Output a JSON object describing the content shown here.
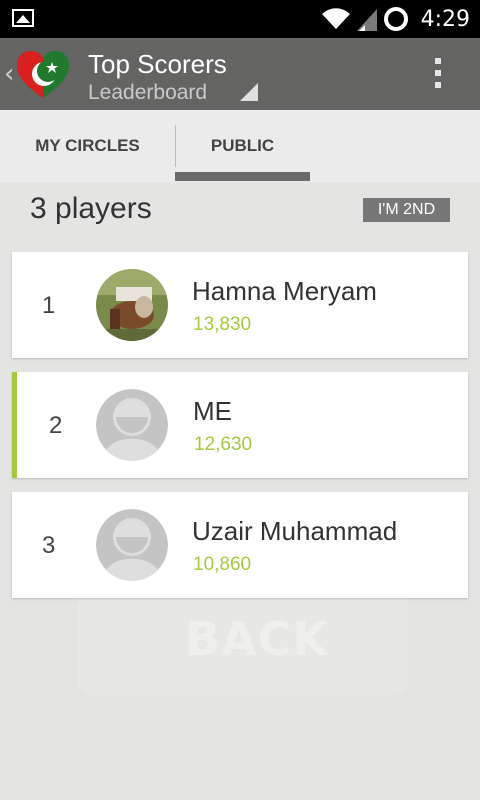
{
  "status_bar": {
    "time": "4:29",
    "icons": [
      "image-notification-icon",
      "wifi-icon",
      "signal-icon",
      "sync-icon"
    ]
  },
  "action_bar": {
    "title": "Top Scorers",
    "subtitle": "Leaderboard",
    "icons": [
      "back-chevron-icon",
      "app-logo-icon",
      "dropdown-triangle-icon",
      "overflow-menu-icon"
    ]
  },
  "tabs": [
    {
      "label": "MY CIRCLES",
      "selected": false
    },
    {
      "label": "PUBLIC",
      "selected": true
    }
  ],
  "leaderboard": {
    "count_label": "3 players",
    "badge_label": "I'M 2ND",
    "players": [
      {
        "rank": "1",
        "name": "Hamna Meryam",
        "score": "13,830",
        "avatar": "photo"
      },
      {
        "rank": "2",
        "name": "ME",
        "score": "12,630",
        "avatar": "default",
        "is_me": true
      },
      {
        "rank": "3",
        "name": "Uzair Muhammad",
        "score": "10,860",
        "avatar": "default"
      }
    ]
  },
  "background": {
    "watermark": "BACK"
  },
  "colors": {
    "accent": "#a6c93f",
    "action_bar": "#646462",
    "tab_indicator": "#6a6a6a"
  }
}
